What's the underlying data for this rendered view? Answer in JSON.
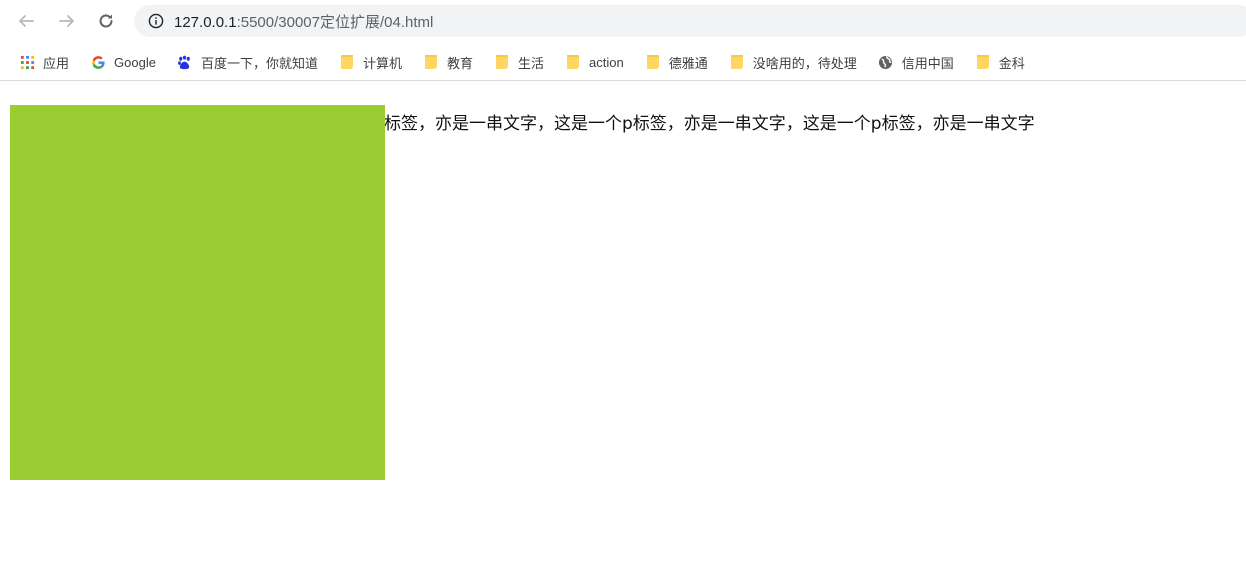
{
  "browser": {
    "url_host": "127.0.0.1",
    "url_path": ":5500/30007定位扩展/04.html",
    "bookmarks": [
      {
        "label": "应用",
        "icon": "apps-grid-icon"
      },
      {
        "label": "Google",
        "icon": "google-icon"
      },
      {
        "label": "百度一下，你就知道",
        "icon": "baidu-paw-icon"
      },
      {
        "label": "计算机",
        "icon": "folder-icon"
      },
      {
        "label": "教育",
        "icon": "folder-icon"
      },
      {
        "label": "生活",
        "icon": "folder-icon"
      },
      {
        "label": "action",
        "icon": "folder-icon"
      },
      {
        "label": "德雅通",
        "icon": "folder-icon"
      },
      {
        "label": "没啥用的，待处理",
        "icon": "folder-icon"
      },
      {
        "label": "信用中国",
        "icon": "globe-icon"
      },
      {
        "label": "金科",
        "icon": "folder-icon"
      }
    ]
  },
  "page": {
    "box_color": "#9acd32",
    "paragraph": "标签，亦是一串文字，这是一个p标签，亦是一串文字，这是一个p标签，亦是一串文字"
  }
}
